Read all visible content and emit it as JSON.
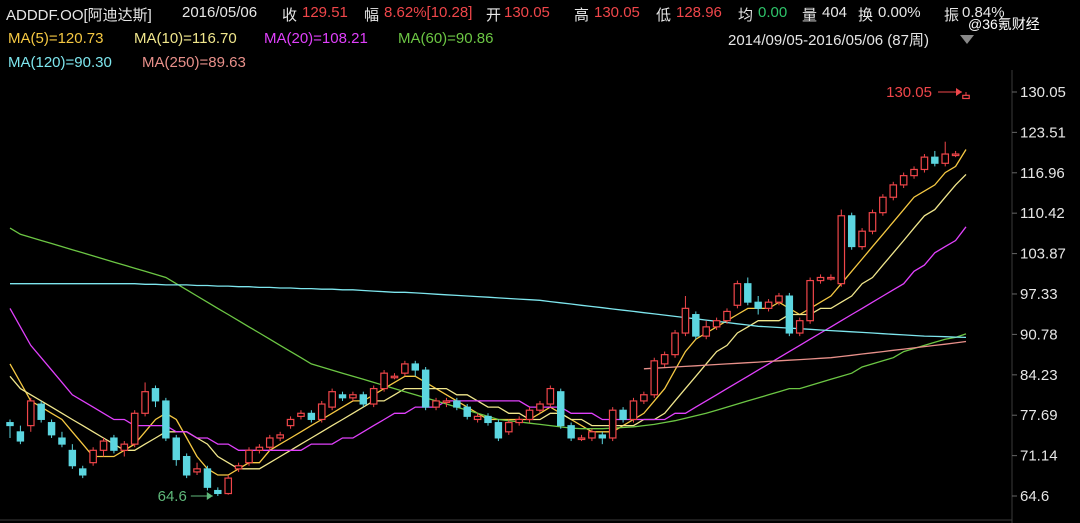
{
  "header": {
    "symbol": "ADDDF.OO[阿迪达斯]",
    "date": "2016/05/06",
    "close_label": "收",
    "close_value": "129.51",
    "change_label": "幅",
    "change_value": "8.62%[10.28]",
    "open_label": "开",
    "open_value": "130.05",
    "high_label": "高",
    "high_value": "130.05",
    "low_label": "低",
    "low_value": "128.96",
    "avg_label": "均",
    "avg_value": "0.00",
    "volume_label": "量",
    "volume_value": "404",
    "turnover_label": "换",
    "turnover_value": "0.00%",
    "amplitude_label": "振",
    "amplitude_value": "0.84%"
  },
  "moving_averages": [
    {
      "label": "MA(5)=120.73",
      "color": "#f5c842"
    },
    {
      "label": "MA(10)=116.70",
      "color": "#f0e68c"
    },
    {
      "label": "MA(20)=108.21",
      "color": "#e040fb"
    },
    {
      "label": "MA(60)=90.86",
      "color": "#6cc644"
    },
    {
      "label": "MA(120)=90.30",
      "color": "#7ee6ee"
    },
    {
      "label": "MA(250)=89.63",
      "color": "#e8908a"
    }
  ],
  "range_label": "2014/09/05-2016/05/06 (87周)",
  "watermark": "@36氪财经",
  "chart_data": {
    "type": "candlestick",
    "title": "ADDDF.OO[阿迪达斯]",
    "y_ticks": [
      "130.05",
      "123.51",
      "116.96",
      "110.42",
      "103.87",
      "97.33",
      "90.78",
      "84.23",
      "77.69",
      "71.14",
      "64.6"
    ],
    "ylim": [
      64.6,
      130.05
    ],
    "grid": false,
    "annotations": [
      {
        "text": "130.05",
        "value": 130.05,
        "type": "high"
      },
      {
        "text": "64.6",
        "value": 64.6,
        "type": "low"
      }
    ],
    "candles": [
      [
        76.5,
        76.0,
        74.0,
        77.0
      ],
      [
        75.0,
        73.5,
        73.0,
        76.0
      ],
      [
        76.0,
        80.0,
        75.0,
        80.5
      ],
      [
        79.5,
        77.0,
        76.5,
        80.0
      ],
      [
        76.5,
        74.5,
        74.0,
        77.0
      ],
      [
        74.0,
        73.0,
        72.5,
        75.0
      ],
      [
        72.0,
        69.5,
        69.0,
        73.0
      ],
      [
        69.0,
        68.0,
        67.5,
        69.5
      ],
      [
        70.0,
        72.0,
        69.5,
        72.5
      ],
      [
        72.0,
        73.5,
        71.0,
        74.0
      ],
      [
        74.0,
        72.0,
        71.5,
        74.5
      ],
      [
        72.0,
        73.0,
        71.0,
        73.5
      ],
      [
        73.0,
        78.0,
        72.5,
        78.5
      ],
      [
        78.0,
        81.5,
        77.5,
        83.0
      ],
      [
        82.0,
        80.0,
        79.0,
        82.5
      ],
      [
        80.0,
        74.0,
        73.5,
        80.5
      ],
      [
        74.0,
        70.5,
        69.5,
        74.5
      ],
      [
        71.0,
        68.0,
        67.5,
        71.5
      ],
      [
        68.5,
        69.0,
        68.0,
        70.0
      ],
      [
        69.0,
        66.0,
        65.5,
        69.5
      ],
      [
        65.5,
        65.0,
        64.6,
        66.0
      ],
      [
        65.0,
        67.5,
        64.8,
        68.0
      ],
      [
        69.0,
        69.5,
        68.5,
        70.0
      ],
      [
        70.0,
        72.0,
        69.5,
        72.5
      ],
      [
        72.0,
        72.5,
        71.5,
        73.0
      ],
      [
        72.5,
        74.0,
        72.0,
        74.5
      ],
      [
        74.0,
        74.5,
        73.5,
        75.0
      ],
      [
        76.0,
        77.0,
        75.5,
        77.5
      ],
      [
        77.5,
        78.0,
        77.0,
        78.5
      ],
      [
        78.0,
        77.0,
        76.5,
        78.5
      ],
      [
        77.0,
        79.5,
        76.5,
        80.0
      ],
      [
        79.0,
        81.5,
        78.5,
        82.0
      ],
      [
        81.0,
        80.5,
        80.0,
        81.5
      ],
      [
        80.5,
        81.0,
        80.0,
        81.5
      ],
      [
        81.0,
        79.5,
        79.0,
        81.5
      ],
      [
        79.5,
        82.0,
        79.0,
        82.5
      ],
      [
        82.0,
        84.5,
        81.5,
        85.0
      ],
      [
        84.0,
        84.0,
        83.5,
        84.5
      ],
      [
        84.5,
        86.0,
        84.0,
        86.5
      ],
      [
        86.0,
        85.0,
        84.0,
        86.5
      ],
      [
        85.0,
        79.0,
        78.5,
        85.5
      ],
      [
        79.0,
        80.0,
        78.5,
        80.5
      ],
      [
        80.0,
        80.0,
        79.0,
        80.5
      ],
      [
        80.0,
        79.0,
        78.5,
        80.5
      ],
      [
        79.0,
        77.5,
        77.0,
        79.5
      ],
      [
        77.0,
        77.5,
        76.5,
        78.0
      ],
      [
        77.5,
        76.5,
        76.0,
        78.0
      ],
      [
        76.5,
        74.0,
        73.5,
        77.0
      ],
      [
        75.0,
        76.5,
        74.5,
        77.0
      ],
      [
        76.5,
        77.0,
        76.0,
        77.5
      ],
      [
        77.0,
        78.5,
        76.5,
        79.0
      ],
      [
        78.5,
        79.5,
        78.0,
        80.0
      ],
      [
        79.5,
        82.0,
        79.0,
        82.5
      ],
      [
        81.5,
        76.0,
        75.5,
        82.0
      ],
      [
        76.0,
        74.0,
        73.5,
        76.5
      ],
      [
        74.0,
        74.0,
        73.5,
        74.5
      ],
      [
        74.0,
        75.0,
        73.5,
        75.5
      ],
      [
        74.5,
        74.0,
        73.0,
        75.0
      ],
      [
        74.0,
        78.5,
        73.5,
        79.0
      ],
      [
        78.5,
        77.0,
        76.5,
        79.0
      ],
      [
        77.0,
        80.0,
        76.5,
        80.5
      ],
      [
        80.0,
        81.0,
        79.5,
        81.5
      ],
      [
        81.0,
        86.5,
        80.5,
        87.0
      ],
      [
        86.0,
        87.5,
        85.5,
        88.0
      ],
      [
        87.5,
        91.0,
        87.0,
        91.5
      ],
      [
        91.0,
        95.0,
        90.5,
        97.0
      ],
      [
        94.0,
        90.5,
        90.0,
        94.5
      ],
      [
        90.5,
        92.0,
        90.0,
        93.0
      ],
      [
        92.0,
        93.0,
        91.5,
        93.5
      ],
      [
        93.0,
        94.5,
        92.5,
        95.0
      ],
      [
        95.5,
        99.0,
        95.0,
        99.5
      ],
      [
        99.0,
        96.0,
        95.5,
        100.0
      ],
      [
        96.0,
        95.0,
        94.0,
        97.0
      ],
      [
        95.0,
        96.0,
        94.5,
        96.5
      ],
      [
        96.0,
        97.0,
        95.5,
        97.5
      ],
      [
        97.0,
        91.0,
        90.5,
        97.5
      ],
      [
        91.0,
        93.0,
        90.5,
        93.5
      ],
      [
        93.0,
        99.5,
        92.5,
        100.0
      ],
      [
        99.5,
        100.0,
        99.0,
        100.5
      ],
      [
        100.0,
        100.0,
        99.5,
        100.5
      ],
      [
        99.0,
        110.0,
        98.5,
        111.0
      ],
      [
        110.0,
        105.0,
        104.5,
        110.5
      ],
      [
        105.0,
        107.5,
        104.5,
        108.0
      ],
      [
        107.5,
        110.5,
        107.0,
        111.0
      ],
      [
        110.5,
        113.0,
        110.0,
        113.5
      ],
      [
        113.0,
        115.0,
        112.5,
        115.5
      ],
      [
        115.0,
        116.5,
        114.5,
        117.0
      ],
      [
        116.5,
        117.5,
        116.0,
        118.0
      ],
      [
        117.5,
        119.5,
        117.0,
        120.0
      ],
      [
        119.5,
        118.5,
        118.0,
        120.5
      ],
      [
        118.5,
        120.0,
        118.0,
        122.0
      ],
      [
        120.0,
        120.0,
        119.5,
        120.5
      ],
      [
        129.0,
        129.51,
        128.96,
        130.05
      ]
    ],
    "series": [
      {
        "name": "MA(5)",
        "color": "#f5c842",
        "values": [
          86,
          83,
          80,
          79,
          78,
          77,
          75,
          73,
          71,
          71,
          71,
          72,
          73,
          75,
          77,
          78,
          77,
          74,
          71,
          69,
          68,
          68,
          69,
          70,
          70,
          72,
          73,
          74,
          75,
          76,
          77,
          78,
          79,
          80,
          80,
          81,
          82,
          83,
          84,
          84,
          83,
          82,
          81,
          80,
          79,
          78,
          77,
          77,
          77,
          77,
          77,
          78,
          79,
          78,
          77,
          76,
          75,
          75,
          75,
          76,
          77,
          78,
          80,
          82,
          85,
          88,
          90,
          91,
          92,
          93,
          94,
          95,
          95,
          95,
          96,
          95,
          94,
          95,
          96,
          97,
          99,
          101,
          103,
          105,
          107,
          109,
          111,
          113,
          114,
          115,
          117,
          118,
          120.73
        ]
      },
      {
        "name": "MA(10)",
        "color": "#f0e68c",
        "values": [
          84,
          82,
          81,
          80,
          79,
          78,
          77,
          76,
          75,
          74,
          73,
          72,
          72,
          73,
          74,
          75,
          75,
          75,
          74,
          73,
          71,
          70,
          69,
          69,
          69,
          70,
          71,
          72,
          73,
          74,
          75,
          76,
          77,
          78,
          79,
          80,
          80,
          81,
          82,
          82,
          82,
          82,
          82,
          81,
          81,
          80,
          79,
          79,
          78,
          78,
          77,
          77,
          78,
          78,
          77,
          77,
          76,
          76,
          76,
          76,
          76,
          77,
          77,
          78,
          80,
          82,
          84,
          86,
          88,
          89,
          91,
          92,
          93,
          93,
          93,
          94,
          94,
          94,
          95,
          95,
          96,
          97,
          99,
          100,
          102,
          104,
          106,
          108,
          110,
          111,
          113,
          115,
          116.7
        ]
      },
      {
        "name": "MA(20)",
        "color": "#e040fb",
        "values": [
          95,
          92,
          89,
          87,
          85,
          83,
          81,
          80,
          79,
          78,
          77,
          77,
          76,
          76,
          76,
          76,
          75,
          75,
          74,
          74,
          73,
          73,
          72,
          72,
          72,
          72,
          72,
          72,
          72,
          73,
          73,
          73,
          74,
          74,
          75,
          76,
          77,
          78,
          78,
          79,
          79,
          79,
          80,
          80,
          80,
          80,
          80,
          80,
          80,
          80,
          79,
          79,
          79,
          79,
          78,
          78,
          78,
          77,
          77,
          77,
          77,
          77,
          77,
          77,
          78,
          78,
          79,
          80,
          81,
          82,
          83,
          84,
          85,
          86,
          87,
          88,
          89,
          90,
          91,
          92,
          93,
          94,
          95,
          96,
          97,
          98,
          99,
          101,
          102,
          104,
          105,
          106,
          108.21
        ]
      },
      {
        "name": "MA(60)",
        "color": "#6cc644",
        "values": [
          108,
          107,
          106.5,
          106,
          105.5,
          105,
          104.5,
          104,
          103.5,
          103,
          102.5,
          102,
          101.5,
          101,
          100.5,
          100,
          99,
          98,
          97,
          96,
          95,
          94,
          93,
          92,
          91,
          90,
          89,
          88,
          87,
          86,
          85.5,
          85,
          84.5,
          84,
          83.5,
          83,
          82.5,
          82,
          81.5,
          81,
          80.5,
          80,
          79.5,
          79,
          78.5,
          78,
          77.5,
          77,
          76.8,
          76.6,
          76.4,
          76.2,
          76,
          75.8,
          75.6,
          75.5,
          75.5,
          75.5,
          75.6,
          75.7,
          75.8,
          76,
          76.2,
          76.5,
          76.8,
          77.2,
          77.6,
          78,
          78.5,
          79,
          79.5,
          80,
          80.5,
          81,
          81.5,
          82,
          82,
          82.5,
          83,
          83.5,
          84,
          84.5,
          85.5,
          86,
          86.5,
          87,
          88,
          88.5,
          89,
          89.5,
          90,
          90.3,
          90.86
        ]
      },
      {
        "name": "MA(120)",
        "color": "#7ee6ee",
        "values": [
          99,
          99,
          99,
          99,
          99,
          99,
          99,
          99,
          99,
          99,
          99,
          99,
          99,
          98.9,
          98.9,
          98.8,
          98.8,
          98.8,
          98.7,
          98.7,
          98.6,
          98.6,
          98.5,
          98.5,
          98.4,
          98.4,
          98.3,
          98.3,
          98.2,
          98.2,
          98.1,
          98.1,
          98.0,
          98.0,
          97.9,
          97.8,
          97.7,
          97.6,
          97.6,
          97.5,
          97.4,
          97.3,
          97.2,
          97.1,
          97.0,
          96.9,
          96.8,
          96.7,
          96.6,
          96.5,
          96.4,
          96.3,
          96.1,
          95.9,
          95.7,
          95.5,
          95.3,
          95.1,
          94.9,
          94.7,
          94.5,
          94.3,
          94.1,
          93.9,
          93.7,
          93.5,
          93.3,
          93.1,
          92.9,
          92.7,
          92.5,
          92.3,
          92.1,
          92,
          91.9,
          91.8,
          91.7,
          91.6,
          91.5,
          91.4,
          91.3,
          91.2,
          91.1,
          91,
          90.9,
          90.8,
          90.7,
          90.6,
          90.5,
          90.45,
          90.4,
          90.35,
          90.3
        ]
      },
      {
        "name": "MA(250)",
        "color": "#e8908a",
        "values": [
          null,
          null,
          null,
          null,
          null,
          null,
          null,
          null,
          null,
          null,
          null,
          null,
          null,
          null,
          null,
          null,
          null,
          null,
          null,
          null,
          null,
          null,
          null,
          null,
          null,
          null,
          null,
          null,
          null,
          null,
          null,
          null,
          null,
          null,
          null,
          null,
          null,
          null,
          null,
          null,
          null,
          null,
          null,
          null,
          null,
          null,
          null,
          null,
          null,
          null,
          null,
          null,
          null,
          null,
          null,
          null,
          null,
          null,
          null,
          null,
          null,
          85.2,
          85.3,
          85.4,
          85.5,
          85.6,
          85.7,
          85.8,
          85.9,
          86,
          86.1,
          86.2,
          86.3,
          86.4,
          86.5,
          86.6,
          86.7,
          86.8,
          86.9,
          87,
          87.2,
          87.4,
          87.6,
          87.8,
          88,
          88.2,
          88.4,
          88.6,
          88.8,
          89,
          89.2,
          89.4,
          89.63
        ]
      }
    ]
  },
  "colors": {
    "up": "#f0464a",
    "down": "#5cd6e0",
    "text": "#e6e6e6"
  }
}
